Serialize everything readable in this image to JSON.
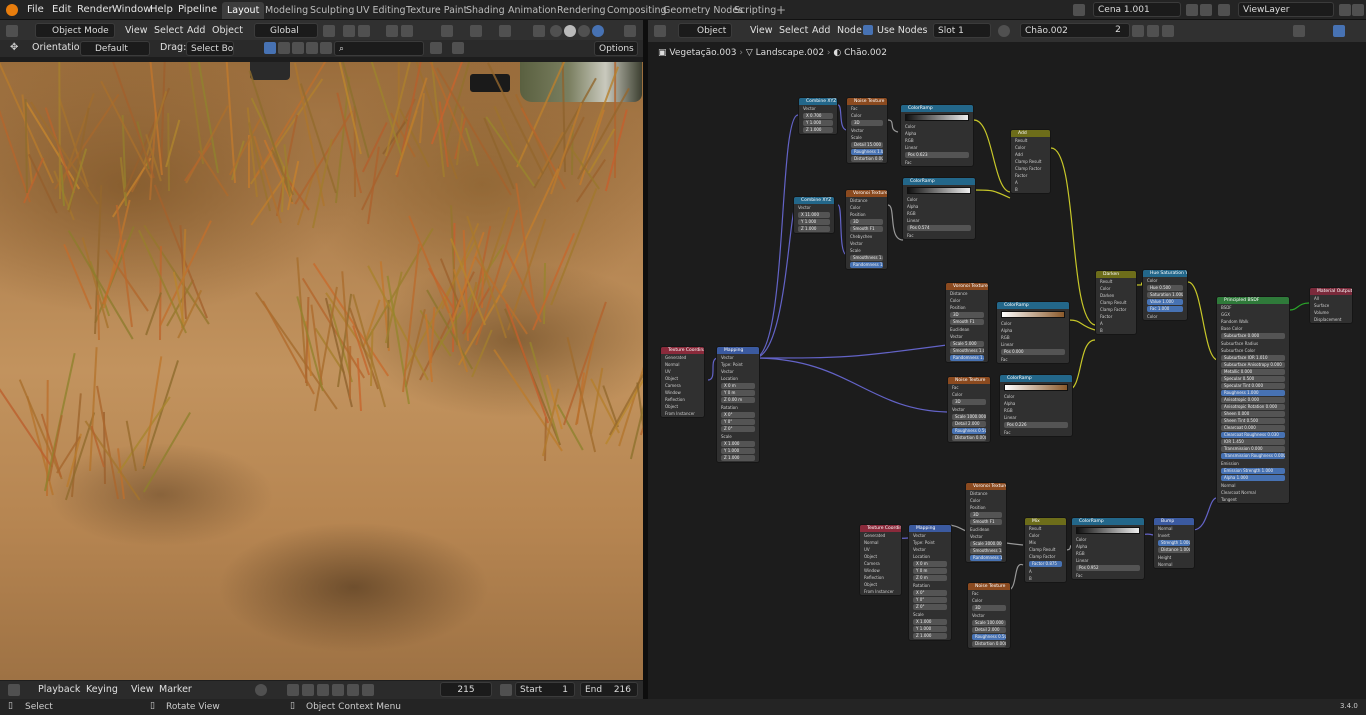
{
  "topbar": {
    "menus": [
      "File",
      "Edit",
      "Render",
      "Window",
      "Help",
      "Pipeline"
    ],
    "workspaces": [
      "Layout",
      "Modeling",
      "Sculpting",
      "UV Editing",
      "Texture Paint",
      "Shading",
      "Animation",
      "Rendering",
      "Compositing",
      "Geometry Nodes",
      "Scripting"
    ],
    "active_workspace": "Layout",
    "scene": "Cena 1.001",
    "view_layer": "ViewLayer"
  },
  "viewport_header": {
    "mode": "Object Mode",
    "menus": [
      "View",
      "Select",
      "Add",
      "Object"
    ],
    "transform": "Global",
    "orientation_label": "Orientation:",
    "orientation": "Default",
    "drag_label": "Drag:",
    "drag": "Select Box",
    "options": "Options"
  },
  "node_header": {
    "editor_type": "Object",
    "menus": [
      "View",
      "Select",
      "Add",
      "Node"
    ],
    "use_nodes": "Use Nodes",
    "slot": "Slot 1",
    "material": "Chão.002",
    "users": "2"
  },
  "breadcrumb": [
    "Vegetação.003",
    "Landscape.002",
    "Chão.002"
  ],
  "timeline": {
    "menus": [
      "Playback",
      "Keying",
      "View",
      "Marker"
    ],
    "current_frame": "215",
    "start_label": "Start",
    "start": "1",
    "end_label": "End",
    "end": "216"
  },
  "statusbar": {
    "select": "Select",
    "rotate": "Rotate View",
    "context": "Object Context Menu",
    "version": "3.4.0"
  },
  "nodes": {
    "combine1": {
      "title": "Combine XYZ",
      "rows": [
        "Vector",
        "X 0.700",
        "Y 1.000",
        "Z 1.000"
      ]
    },
    "noise1": {
      "title": "Noise Texture",
      "rows": [
        "Fac",
        "Color",
        "3D",
        "Vector",
        "Scale",
        "Detail 15.000",
        "Roughness 1.000",
        "Distortion 0.000"
      ]
    },
    "ramp1": {
      "title": "ColorRamp",
      "rows": [
        "Color",
        "Alpha",
        "RGB",
        "Linear",
        "Pos 0.623",
        "Fac"
      ]
    },
    "add1": {
      "title": "Add",
      "rows": [
        "Result",
        "Color",
        "Add",
        "Clamp Result",
        "Clamp Factor",
        "Factor",
        "A",
        "B"
      ]
    },
    "combine2": {
      "title": "Combine XYZ",
      "rows": [
        "Vector",
        "X 11.000",
        "Y 1.000",
        "Z 1.000"
      ]
    },
    "voronoi1": {
      "title": "Voronoi Texture",
      "rows": [
        "Distance",
        "Color",
        "Position",
        "3D",
        "Smooth F1",
        "Chebychev",
        "Vector",
        "Scale",
        "Smoothness 1.000",
        "Randomness 1.000"
      ]
    },
    "ramp2": {
      "title": "ColorRamp",
      "rows": [
        "Color",
        "Alpha",
        "RGB",
        "Linear",
        "Pos 0.574",
        "Fac"
      ]
    },
    "texcoord1": {
      "title": "Texture Coordinate",
      "rows": [
        "Generated",
        "Normal",
        "UV",
        "Object",
        "Camera",
        "Window",
        "Reflection",
        "Object",
        "From Instancer"
      ]
    },
    "mapping1": {
      "title": "Mapping",
      "rows": [
        "Vector",
        "Type: Point",
        "Vector",
        "Location",
        "X 0 m",
        "Y 0 m",
        "Z 0.00 m",
        "Rotation",
        "X 0°",
        "Y 0°",
        "Z 0°",
        "Scale",
        "X 1.000",
        "Y 1.000",
        "Z 1.000"
      ]
    },
    "voronoi2": {
      "title": "Voronoi Texture",
      "rows": [
        "Distance",
        "Color",
        "Position",
        "3D",
        "Smooth F1",
        "Euclidean",
        "Vector",
        "Scale 5.000",
        "Smoothness 1.000",
        "Randomness 1.000"
      ]
    },
    "ramp3": {
      "title": "ColorRamp",
      "rows": [
        "Color",
        "Alpha",
        "RGB",
        "Linear",
        "Pos 0.000",
        "Fac"
      ]
    },
    "noise2": {
      "title": "Noise Texture",
      "rows": [
        "Fac",
        "Color",
        "3D",
        "Vector",
        "Scale 1000.000",
        "Detail 2.000",
        "Roughness 0.500",
        "Distortion 0.000"
      ]
    },
    "ramp4": {
      "title": "ColorRamp",
      "rows": [
        "Color",
        "Alpha",
        "RGB",
        "Linear",
        "Pos 0.226",
        "Fac"
      ]
    },
    "darken": {
      "title": "Darken",
      "rows": [
        "Result",
        "Color",
        "Darken",
        "Clamp Result",
        "Clamp Factor",
        "Factor",
        "A",
        "B"
      ]
    },
    "hsv": {
      "title": "Hue Saturation Value",
      "rows": [
        "Color",
        "Hue 0.500",
        "Saturation 1.000",
        "Value 1.000",
        "Fac 1.000",
        "Color"
      ]
    },
    "bsdf": {
      "title": "Principled BSDF",
      "rows": [
        "BSDF",
        "GGX",
        "Random Walk",
        "Base Color",
        "Subsurface 0.000",
        "Subsurface Radius",
        "Subsurface Color",
        "Subsurface IOR 1.010",
        "Subsurface Anisotropy 0.000",
        "Metallic 0.000",
        "Specular 0.500",
        "Specular Tint 0.000",
        "Roughness 1.000",
        "Anisotropic 0.000",
        "Anisotropic Rotation 0.000",
        "Sheen 0.000",
        "Sheen Tint 0.500",
        "Clearcoat 0.000",
        "Clearcoat Roughness 0.030",
        "IOR 1.450",
        "Transmission 0.000",
        "Transmission Roughness 0.000",
        "Emission",
        "Emission Strength 1.000",
        "Alpha 1.000",
        "Normal",
        "Clearcoat Normal",
        "Tangent"
      ]
    },
    "output": {
      "title": "Material Output",
      "rows": [
        "All",
        "Surface",
        "Volume",
        "Displacement"
      ]
    },
    "texcoord2": {
      "title": "Texture Coordinate",
      "rows": [
        "Generated",
        "Normal",
        "UV",
        "Object",
        "Camera",
        "Window",
        "Reflection",
        "Object",
        "From Instancer"
      ]
    },
    "mapping2": {
      "title": "Mapping",
      "rows": [
        "Vector",
        "Type: Point",
        "Vector",
        "Location",
        "X 0 m",
        "Y 0 m",
        "Z 0 m",
        "Rotation",
        "X 0°",
        "Y 0°",
        "Z 0°",
        "Scale",
        "X 1.000",
        "Y 1.000",
        "Z 1.000"
      ]
    },
    "voronoi3": {
      "title": "Voronoi Texture",
      "rows": [
        "Distance",
        "Color",
        "Position",
        "3D",
        "Smooth F1",
        "Euclidean",
        "Vector",
        "Scale 3000.000",
        "Smoothness 1.000",
        "Randomness 1.000"
      ]
    },
    "noise3": {
      "title": "Noise Texture",
      "rows": [
        "Fac",
        "Color",
        "3D",
        "Vector",
        "Scale 100.000",
        "Detail 2.000",
        "Roughness 0.500",
        "Distortion 0.000"
      ]
    },
    "mix3": {
      "title": "Mix",
      "rows": [
        "Result",
        "Color",
        "Mix",
        "Clamp Result",
        "Clamp Factor",
        "Factor 0.875",
        "A",
        "B"
      ]
    },
    "ramp5": {
      "title": "ColorRamp",
      "rows": [
        "Color",
        "Alpha",
        "RGB",
        "Linear",
        "Pos 0.952",
        "Fac"
      ]
    },
    "bump": {
      "title": "Bump",
      "rows": [
        "Normal",
        "Invert",
        "Strength 1.000",
        "Distance 1.000",
        "Height",
        "Normal"
      ]
    }
  }
}
